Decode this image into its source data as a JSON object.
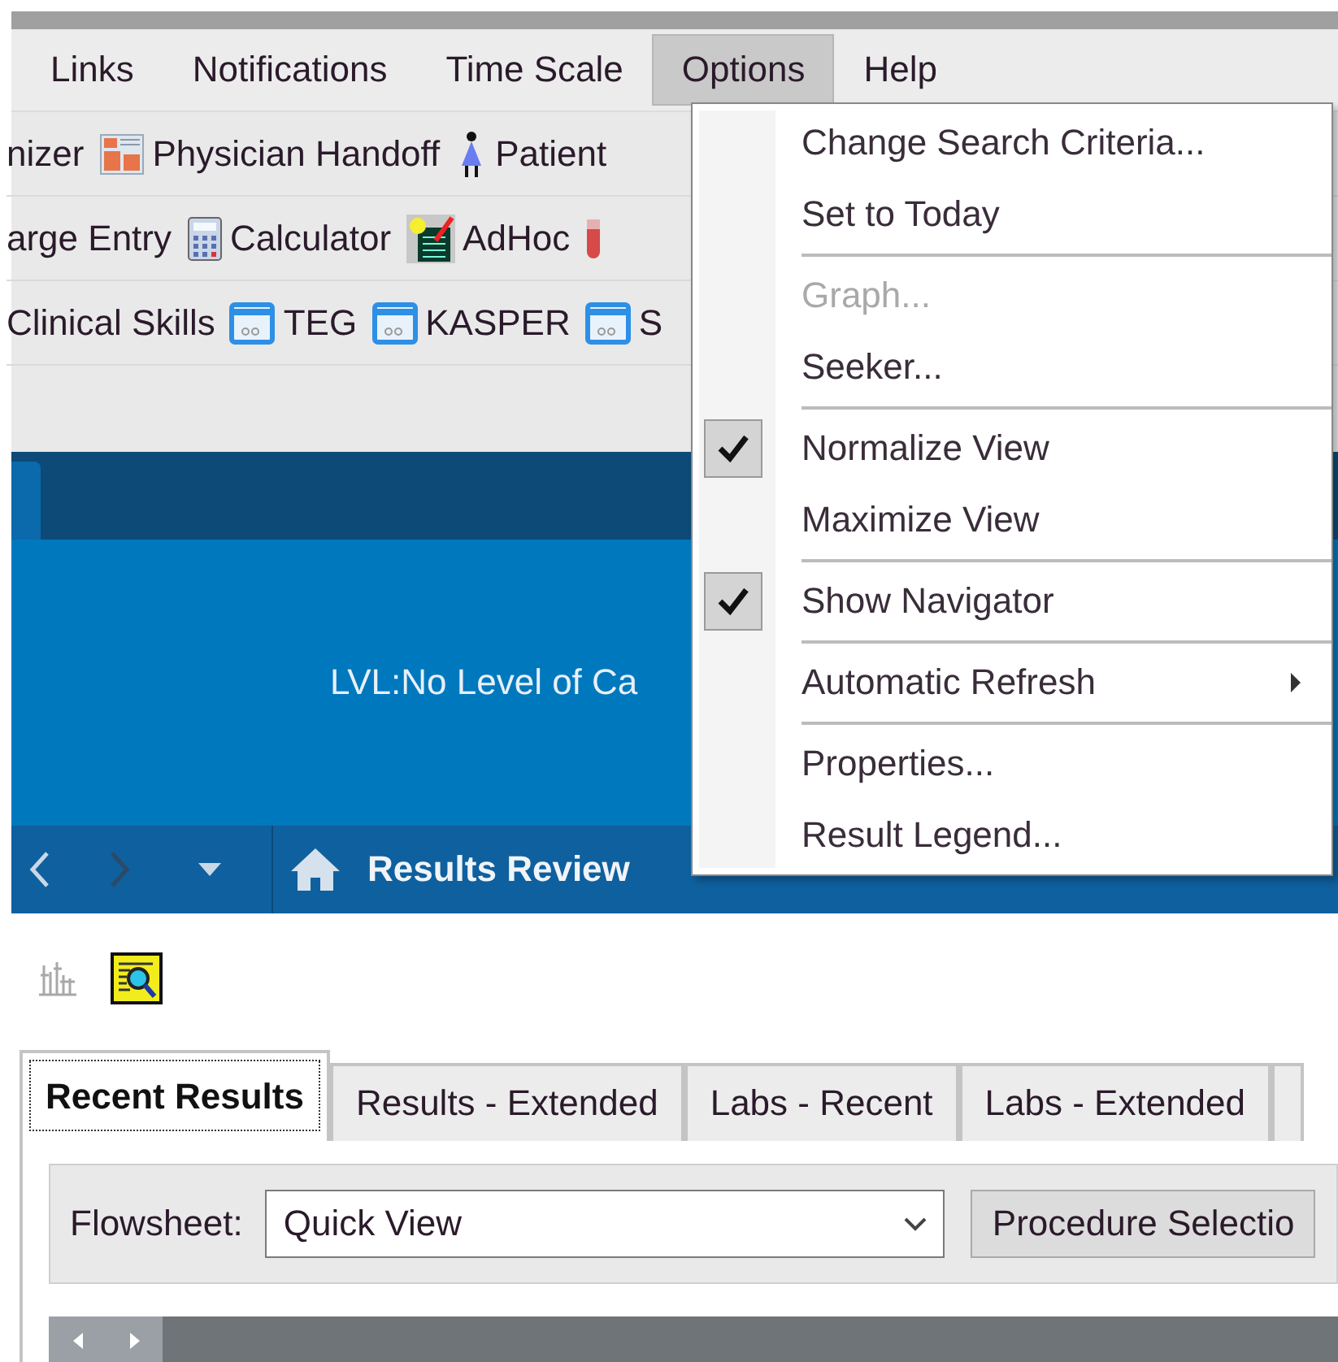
{
  "menu_bar": [
    {
      "label": "Links",
      "selected": false
    },
    {
      "label": "Notifications",
      "selected": false
    },
    {
      "label": "Time Scale",
      "selected": false
    },
    {
      "label": "Options",
      "selected": true
    },
    {
      "label": "Help",
      "selected": false
    }
  ],
  "toolbar_rows": [
    [
      {
        "label": "nizer",
        "kind": "plain"
      },
      {
        "label": "Physician Handoff",
        "kind": "sheet"
      },
      {
        "label": "Patient",
        "kind": "figure"
      }
    ],
    [
      {
        "label": "arge Entry",
        "kind": "plain"
      },
      {
        "label": "Calculator",
        "kind": "calculator"
      },
      {
        "label": "AdHoc",
        "kind": "note"
      },
      {
        "kind": "tube"
      }
    ],
    [
      {
        "label": "Clinical Skills",
        "kind": "plain"
      },
      {
        "label": "TEG",
        "kind": "window"
      },
      {
        "label": "KASPER",
        "kind": "window"
      },
      {
        "label": "S",
        "kind": "window"
      }
    ]
  ],
  "banner": {
    "text": "LVL:No Level of Ca"
  },
  "nav": {
    "title": "Results Review"
  },
  "tabs": [
    {
      "label": "Recent Results",
      "selected": true
    },
    {
      "label": "Results - Extended",
      "selected": false
    },
    {
      "label": "Labs - Recent",
      "selected": false
    },
    {
      "label": "Labs - Extended",
      "selected": false
    }
  ],
  "flowsheet": {
    "label": "Flowsheet:",
    "value": "Quick View",
    "button": "Procedure Selectio"
  },
  "options_menu": [
    {
      "kind": "item",
      "label": "Change Search Criteria...",
      "checked": false,
      "disabled": false
    },
    {
      "kind": "item",
      "label": "Set to Today",
      "checked": false,
      "disabled": false
    },
    {
      "kind": "separator"
    },
    {
      "kind": "item",
      "label": "Graph...",
      "checked": false,
      "disabled": true
    },
    {
      "kind": "item",
      "label": "Seeker...",
      "checked": false,
      "disabled": false
    },
    {
      "kind": "separator"
    },
    {
      "kind": "item",
      "label": "Normalize View",
      "checked": true,
      "disabled": false
    },
    {
      "kind": "item",
      "label": "Maximize View",
      "checked": false,
      "disabled": false
    },
    {
      "kind": "separator"
    },
    {
      "kind": "item",
      "label": "Show Navigator",
      "checked": true,
      "disabled": false
    },
    {
      "kind": "separator"
    },
    {
      "kind": "submenu",
      "label": "Automatic Refresh",
      "checked": false,
      "disabled": false
    },
    {
      "kind": "separator"
    },
    {
      "kind": "item",
      "label": "Properties...",
      "checked": false,
      "disabled": false
    },
    {
      "kind": "item",
      "label": "Result Legend...",
      "checked": false,
      "disabled": false
    }
  ]
}
